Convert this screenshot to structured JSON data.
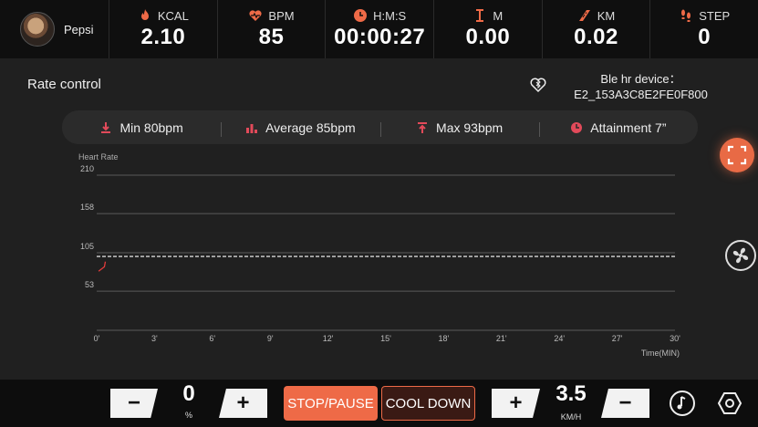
{
  "user": {
    "name": "Pepsi"
  },
  "stats": [
    {
      "icon": "flame-icon",
      "label": "KCAL",
      "value": "2.10"
    },
    {
      "icon": "heart-pulse-icon",
      "label": "BPM",
      "value": "85"
    },
    {
      "icon": "clock-icon",
      "label": "H:M:S",
      "value": "00:00:27"
    },
    {
      "icon": "distance-marker-icon",
      "label": "M",
      "value": "0.00"
    },
    {
      "icon": "road-icon",
      "label": "KM",
      "value": "0.02"
    },
    {
      "icon": "footsteps-icon",
      "label": "STEP",
      "value": "0"
    }
  ],
  "panel": {
    "title": "Rate control",
    "ble_label": "Ble hr device：",
    "ble_id": "E2_153A3C8E2FE0F800"
  },
  "summary": [
    {
      "icon": "min-arrow-icon",
      "text": "Min 80bpm"
    },
    {
      "icon": "bar-chart-icon",
      "text": "Average 85bpm"
    },
    {
      "icon": "max-arrow-icon",
      "text": "Max 93bpm"
    },
    {
      "icon": "target-icon",
      "text": "Attainment 7”"
    }
  ],
  "chart_data": {
    "type": "line",
    "ylabel": "Heart Rate",
    "xlabel": "Time(MIN)",
    "y_ticks": [
      210,
      158,
      105,
      53
    ],
    "ylim": [
      0,
      210
    ],
    "x_ticks": [
      "0'",
      "3'",
      "6'",
      "9'",
      "12'",
      "15'",
      "18'",
      "21'",
      "24'",
      "27'",
      "30'"
    ],
    "xlim": [
      0,
      30
    ],
    "target_line": 100,
    "series": [
      {
        "x": [
          0.1,
          0.2,
          0.3,
          0.4,
          0.45
        ],
        "y": [
          80,
          82,
          84,
          86,
          93
        ]
      }
    ],
    "colors": {
      "line": "#e23b3b",
      "grid": "#5a5a5a",
      "target": "#ffffff"
    },
    "grid": true
  },
  "controls": {
    "incline_value": "0",
    "incline_unit": "%",
    "minus_label": "−",
    "plus_label": "+",
    "stop_label": "STOP/PAUSE",
    "cool_label": "COOL DOWN",
    "speed_value": "3.5",
    "speed_unit": "KM/H"
  },
  "colors": {
    "accent": "#ee6a47",
    "background": "#1b1b1b"
  }
}
